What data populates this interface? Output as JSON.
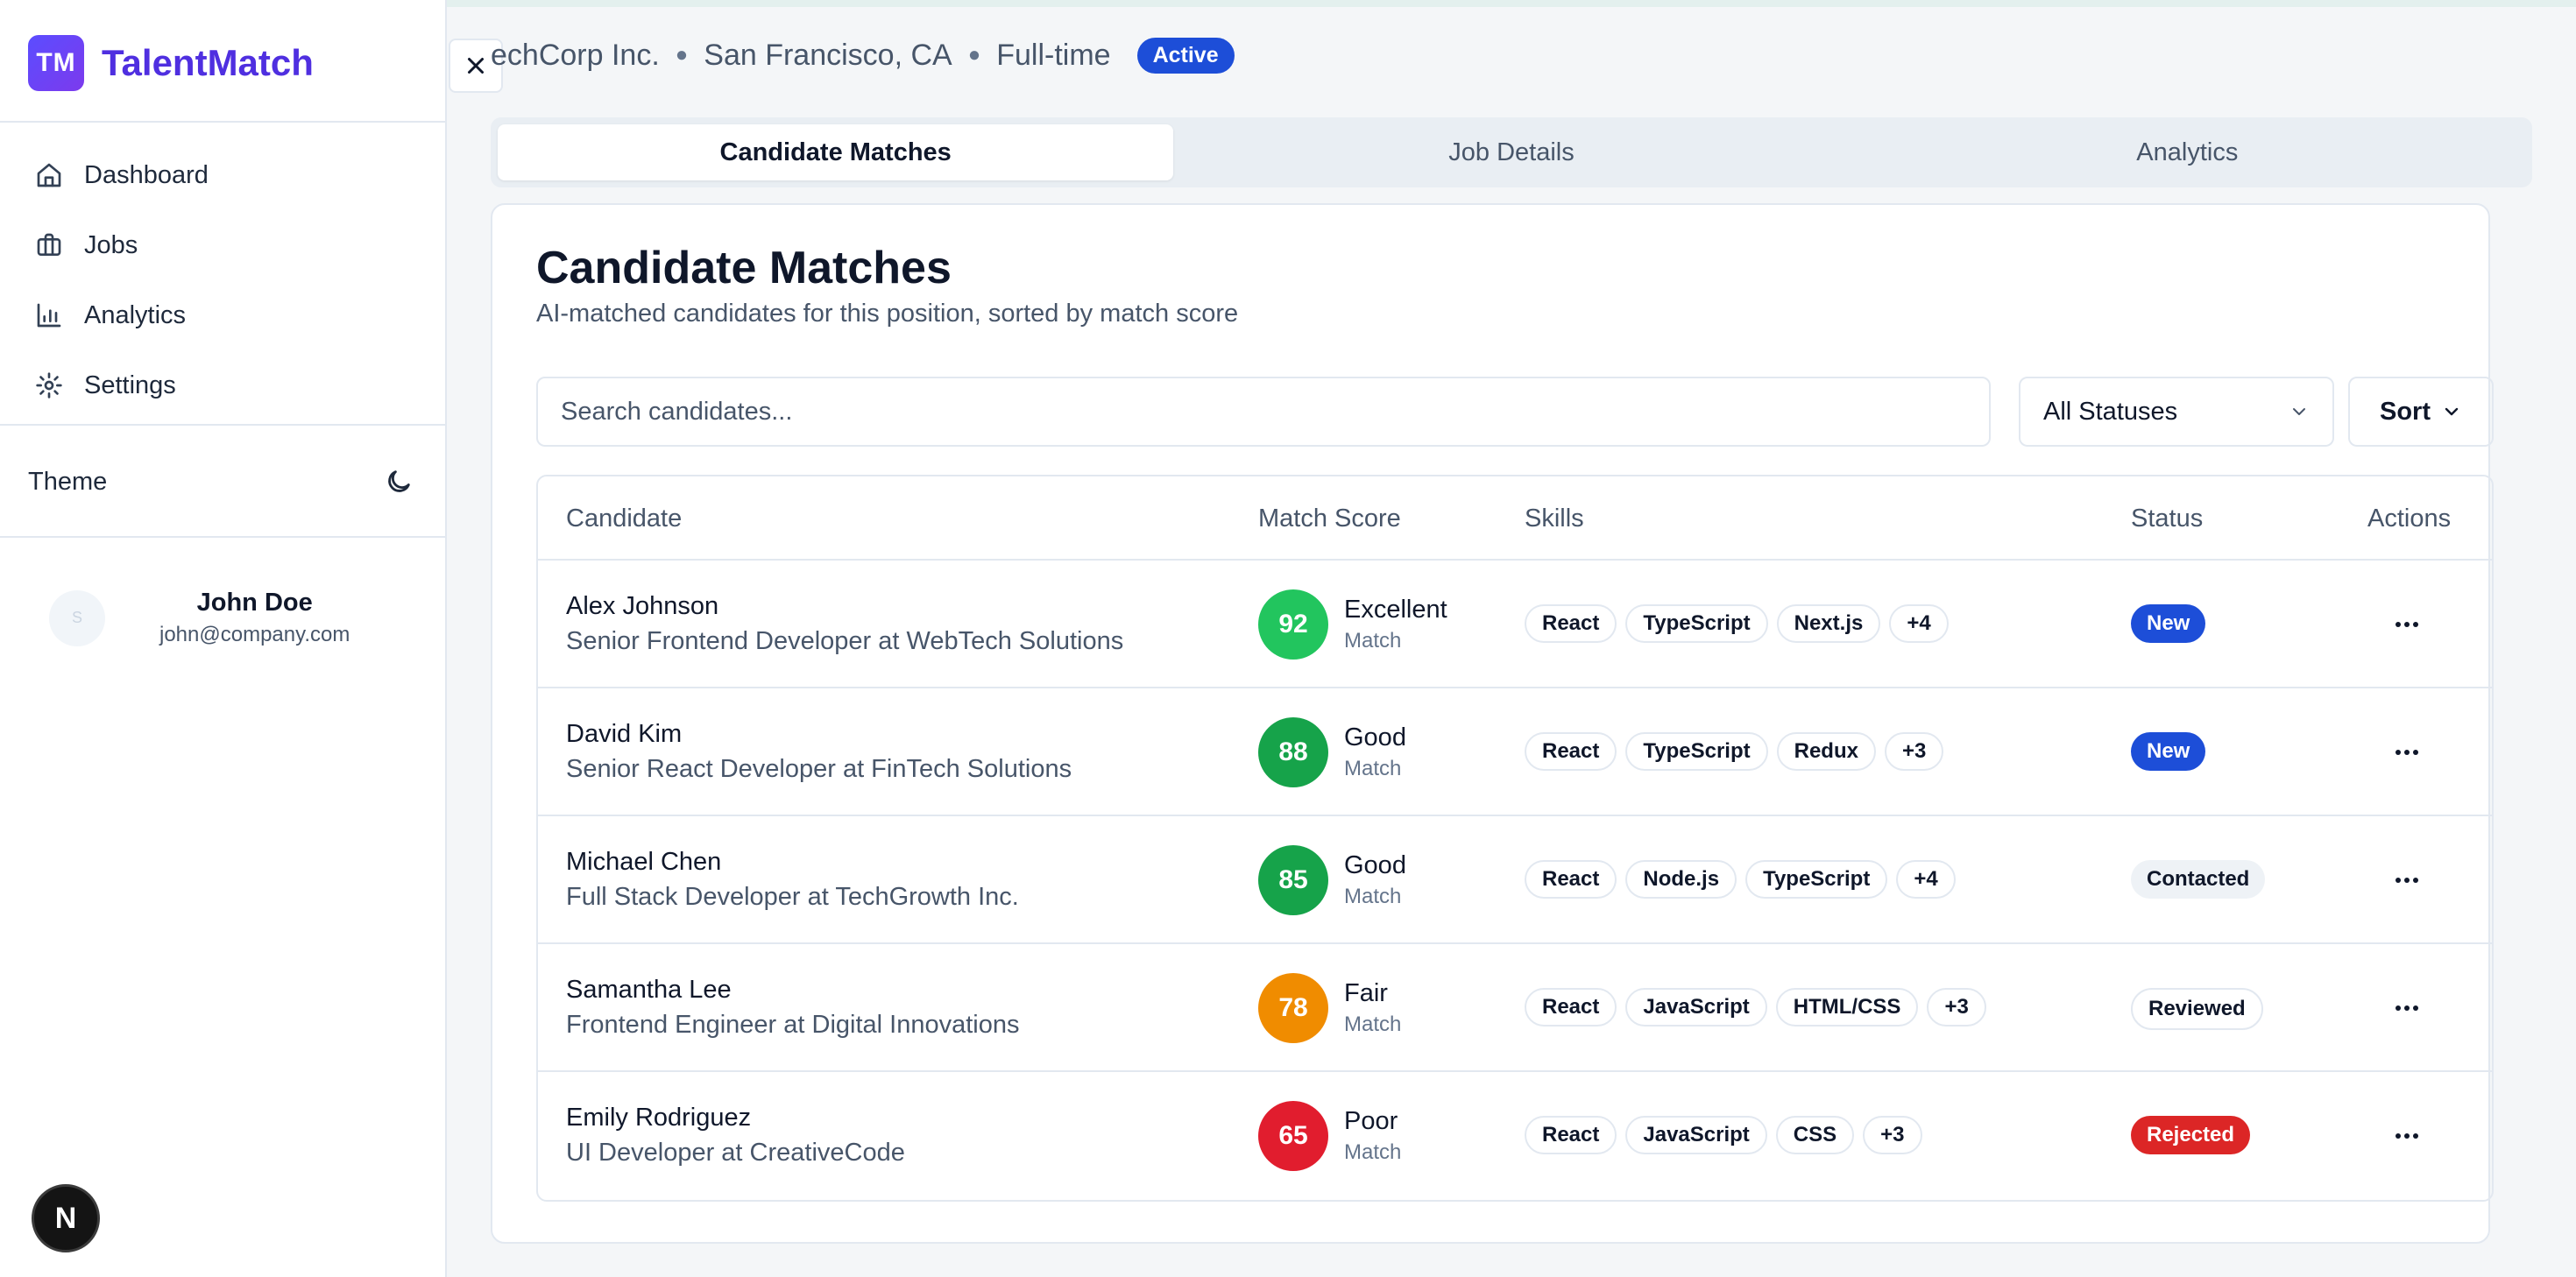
{
  "brand": {
    "logo": "TM",
    "name": "TalentMatch",
    "accent": "#5b4dff"
  },
  "sidebar": {
    "nav": [
      {
        "label": "Dashboard",
        "icon": "home-icon"
      },
      {
        "label": "Jobs",
        "icon": "briefcase-icon"
      },
      {
        "label": "Analytics",
        "icon": "bar-chart-icon"
      },
      {
        "label": "Settings",
        "icon": "gear-icon"
      }
    ],
    "theme_label": "Theme",
    "user": {
      "avatar": "S",
      "name": "John Doe",
      "email": "john@company.com"
    },
    "dev_badge": "N"
  },
  "job": {
    "company": "echCorp Inc.",
    "location": "San Francisco, CA",
    "type": "Full-time",
    "status": "Active"
  },
  "tabs": [
    {
      "label": "Candidate Matches",
      "active": true
    },
    {
      "label": "Job Details",
      "active": false
    },
    {
      "label": "Analytics",
      "active": false
    }
  ],
  "card": {
    "title": "Candidate Matches",
    "subtitle": "AI-matched candidates for this position, sorted by match score",
    "search_placeholder": "Search candidates...",
    "status_filter": "All Statuses",
    "sort_label": "Sort"
  },
  "table": {
    "headers": {
      "candidate": "Candidate",
      "score": "Match Score",
      "skills": "Skills",
      "status": "Status",
      "actions": "Actions"
    },
    "rows": [
      {
        "name": "Alex Johnson",
        "role": "Senior Frontend Developer at WebTech Solutions",
        "score": "92",
        "label": "Excellent",
        "sub": "Match",
        "color": "#22c55e",
        "skills": [
          "React",
          "TypeScript",
          "Next.js",
          "+4"
        ],
        "status": "New",
        "status_kind": "new"
      },
      {
        "name": "David Kim",
        "role": "Senior React Developer at FinTech Solutions",
        "score": "88",
        "label": "Good",
        "sub": "Match",
        "color": "#16a34a",
        "skills": [
          "React",
          "TypeScript",
          "Redux",
          "+3"
        ],
        "status": "New",
        "status_kind": "new"
      },
      {
        "name": "Michael Chen",
        "role": "Full Stack Developer at TechGrowth Inc.",
        "score": "85",
        "label": "Good",
        "sub": "Match",
        "color": "#16a34a",
        "skills": [
          "React",
          "Node.js",
          "TypeScript",
          "+4"
        ],
        "status": "Contacted",
        "status_kind": "contacted"
      },
      {
        "name": "Samantha Lee",
        "role": "Frontend Engineer at Digital Innovations",
        "score": "78",
        "label": "Fair",
        "sub": "Match",
        "color": "#f08c00",
        "skills": [
          "React",
          "JavaScript",
          "HTML/CSS",
          "+3"
        ],
        "status": "Reviewed",
        "status_kind": "reviewed"
      },
      {
        "name": "Emily Rodriguez",
        "role": "UI Developer at CreativeCode",
        "score": "65",
        "label": "Poor",
        "sub": "Match",
        "color": "#e11d2e",
        "skills": [
          "React",
          "JavaScript",
          "CSS",
          "+3"
        ],
        "status": "Rejected",
        "status_kind": "rejected"
      }
    ]
  }
}
